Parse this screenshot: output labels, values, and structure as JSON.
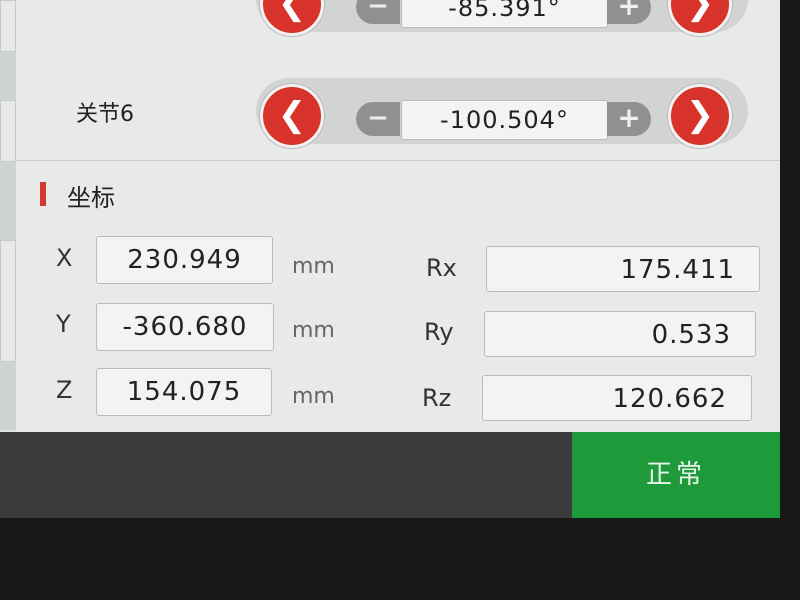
{
  "joint_top": {
    "value": "-85.391°"
  },
  "joint6": {
    "label": "关节6",
    "value": "-100.504°",
    "dec_icon": "minus-icon",
    "inc_icon": "plus-icon",
    "prev_icon": "arrow-left-icon",
    "next_icon": "arrow-right-icon"
  },
  "coordinates": {
    "title": "坐标",
    "accent_color": "#d23a2e",
    "position": [
      {
        "axis": "X",
        "value": "230.949",
        "unit": "mm"
      },
      {
        "axis": "Y",
        "value": "-360.680",
        "unit": "mm"
      },
      {
        "axis": "Z",
        "value": "154.075",
        "unit": "mm"
      }
    ],
    "rotation": [
      {
        "axis": "Rx",
        "value": "175.411"
      },
      {
        "axis": "Ry",
        "value": "0.533"
      },
      {
        "axis": "Rz",
        "value": "120.662"
      }
    ]
  },
  "status": {
    "label": "正常",
    "color": "#1e9a3b"
  }
}
